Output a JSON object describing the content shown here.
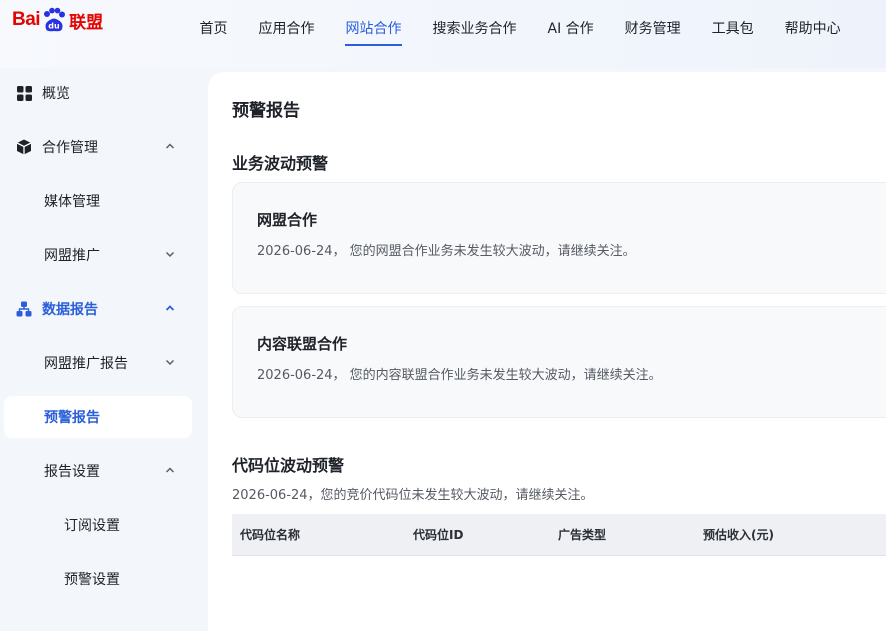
{
  "header": {
    "logo": {
      "bai": "Bai",
      "du": "du",
      "lianmeng": "联盟"
    },
    "nav": [
      {
        "label": "首页",
        "active": false
      },
      {
        "label": "应用合作",
        "active": false
      },
      {
        "label": "网站合作",
        "active": true
      },
      {
        "label": "搜索业务合作",
        "active": false
      },
      {
        "label": "AI 合作",
        "active": false
      },
      {
        "label": "财务管理",
        "active": false
      },
      {
        "label": "工具包",
        "active": false
      },
      {
        "label": "帮助中心",
        "active": false
      }
    ]
  },
  "sidebar": {
    "items": [
      {
        "label": "概览",
        "icon": "grid-icon"
      },
      {
        "label": "合作管理",
        "icon": "cube-icon",
        "chevron": "up"
      },
      {
        "label": "媒体管理"
      },
      {
        "label": "网盟推广",
        "chevron": "down"
      },
      {
        "label": "数据报告",
        "icon": "hierarchy-icon",
        "chevron": "up",
        "active": true
      },
      {
        "label": "网盟推广报告",
        "chevron": "down"
      },
      {
        "label": "预警报告",
        "selected": true
      },
      {
        "label": "报告设置",
        "chevron": "up"
      },
      {
        "label": "订阅设置"
      },
      {
        "label": "预警设置"
      }
    ]
  },
  "main": {
    "page_title": "预警报告",
    "business_section": {
      "title": "业务波动预警",
      "cards": [
        {
          "title": "网盟合作",
          "desc": "2026-06-24， 您的网盟合作业务未发生较大波动，请继续关注。"
        },
        {
          "title": "内容联盟合作",
          "desc": "2026-06-24， 您的内容联盟合作业务未发生较大波动，请继续关注。"
        }
      ]
    },
    "code_section": {
      "title": "代码位波动预警",
      "desc": "2026-06-24，您的竞价代码位未发生较大波动，请继续关注。",
      "columns": [
        "代码位名称",
        "代码位ID",
        "广告类型",
        "预估收入(元)"
      ]
    }
  },
  "colors": {
    "brand_red": "#e10602",
    "brand_blue": "#2a5fd9",
    "logo_blue": "#2932e1"
  }
}
